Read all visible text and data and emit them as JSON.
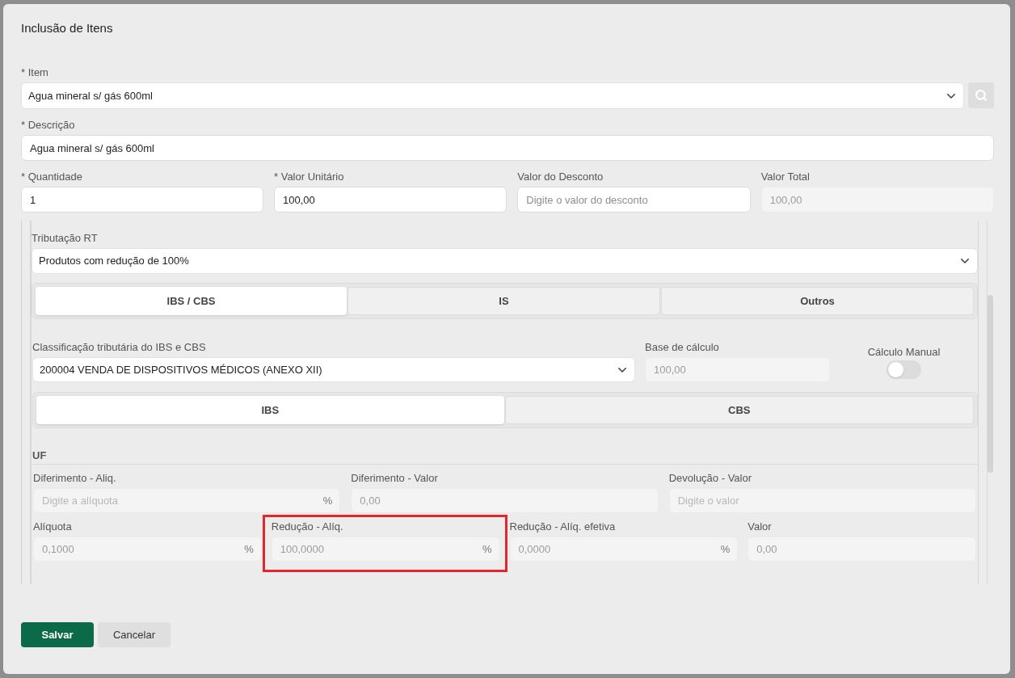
{
  "dialog": {
    "title": "Inclusão de Itens"
  },
  "item": {
    "label": "* Item",
    "value": "Agua mineral s/ gás 600ml"
  },
  "description": {
    "label": "* Descrição",
    "value": "Agua mineral s/ gás 600ml"
  },
  "amounts": [
    {
      "label": "* Quantidade",
      "value": "1",
      "disabled": false
    },
    {
      "label": "* Valor Unitário",
      "value": "100,00",
      "disabled": false
    },
    {
      "label": "Valor do Desconto",
      "placeholder": "Digite o valor do desconto",
      "disabled": false
    },
    {
      "label": "Valor Total",
      "value": "100,00",
      "disabled": true
    }
  ],
  "tax_regime": {
    "label": "Tributação RT",
    "value": "Produtos com redução de 100%"
  },
  "tax_tabs": [
    {
      "label": "IBS / CBS",
      "selected": true
    },
    {
      "label": "IS",
      "selected": false
    },
    {
      "label": "Outros",
      "selected": false
    }
  ],
  "classification": {
    "label": "Classificação tributária do IBS e CBS",
    "value": "200004 VENDA DE DISPOSITIVOS MÉDICOS (ANEXO XII)"
  },
  "calculation_base": {
    "label": "Base de cálculo",
    "value": "100,00",
    "disabled": true
  },
  "manual_calculation": {
    "label": "Cálculo Manual",
    "on": false
  },
  "sub_tabs": [
    {
      "label": "IBS",
      "selected": true
    },
    {
      "label": "CBS",
      "selected": false
    }
  ],
  "uf": {
    "title": "UF",
    "rows": [
      [
        {
          "label": "Diferimento - Aliq.",
          "placeholder": "Digite a alíquota",
          "suffix": "%",
          "disabled": true,
          "highlighted": false
        },
        {
          "label": "Diferimento - Valor",
          "value": "0,00",
          "disabled": true,
          "highlighted": false
        },
        {
          "label": "Devolução - Valor",
          "placeholder": "Digite o valor",
          "disabled": true,
          "highlighted": false
        }
      ],
      [
        {
          "label": "Alíquota",
          "value": "0,1000",
          "suffix": "%",
          "disabled": true,
          "highlighted": false
        },
        {
          "label": "Redução - Alíq.",
          "value": "100,0000",
          "suffix": "%",
          "disabled": true,
          "highlighted": true
        },
        {
          "label": "Redução - Alíq. efetiva",
          "value": "0,0000",
          "suffix": "%",
          "disabled": true,
          "highlighted": false
        },
        {
          "label": "Valor",
          "value": "0,00",
          "disabled": true,
          "highlighted": false
        }
      ]
    ]
  },
  "actions": [
    {
      "label": "Salvar",
      "kind": "primary"
    },
    {
      "label": "Cancelar",
      "kind": "secondary"
    }
  ]
}
